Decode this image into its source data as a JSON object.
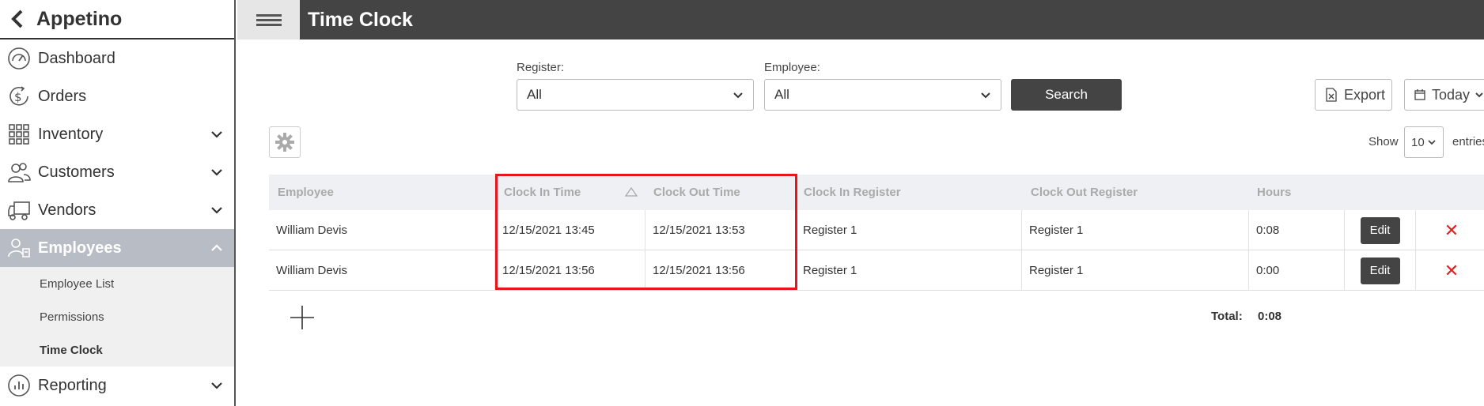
{
  "sidebar": {
    "brand": "Appetino",
    "items": [
      {
        "label": "Dashboard",
        "icon": "dashboard-gauge-icon"
      },
      {
        "label": "Orders",
        "icon": "orders-dollar-icon"
      },
      {
        "label": "Inventory",
        "icon": "inventory-grid-icon"
      },
      {
        "label": "Customers",
        "icon": "customers-people-icon"
      },
      {
        "label": "Vendors",
        "icon": "vendors-truck-icon"
      },
      {
        "label": "Employees",
        "icon": "employees-icon"
      },
      {
        "label": "Reporting",
        "icon": "reporting-chart-icon"
      }
    ],
    "subitems": [
      {
        "label": "Employee List"
      },
      {
        "label": "Permissions"
      },
      {
        "label": "Time Clock"
      }
    ]
  },
  "header": {
    "title": "Time Clock"
  },
  "filters": {
    "register_label": "Register:",
    "register_value": "All",
    "employee_label": "Employee:",
    "employee_value": "All",
    "search_label": "Search",
    "export_label": "Export",
    "date_label": "Today"
  },
  "table": {
    "show_label": "Show",
    "entries_value": "10",
    "entries_label": "entries",
    "columns": [
      "Employee",
      "Clock In Time",
      "Clock Out Time",
      "Clock In Register",
      "Clock Out Register",
      "Hours"
    ],
    "rows": [
      {
        "employee": "William Devis",
        "clock_in": "12/15/2021 13:45",
        "clock_out": "12/15/2021 13:53",
        "in_register": "Register 1",
        "out_register": "Register 1",
        "hours": "0:08",
        "edit": "Edit"
      },
      {
        "employee": "William Devis",
        "clock_in": "12/15/2021 13:56",
        "clock_out": "12/15/2021 13:56",
        "in_register": "Register 1",
        "out_register": "Register 1",
        "hours": "0:00",
        "edit": "Edit"
      }
    ],
    "total_label": "Total:",
    "total_value": "0:08"
  },
  "colors": {
    "highlight": "#e8141e",
    "topbar": "#444444",
    "active_nav": "#b8bcc4",
    "delete": "#e02020"
  }
}
